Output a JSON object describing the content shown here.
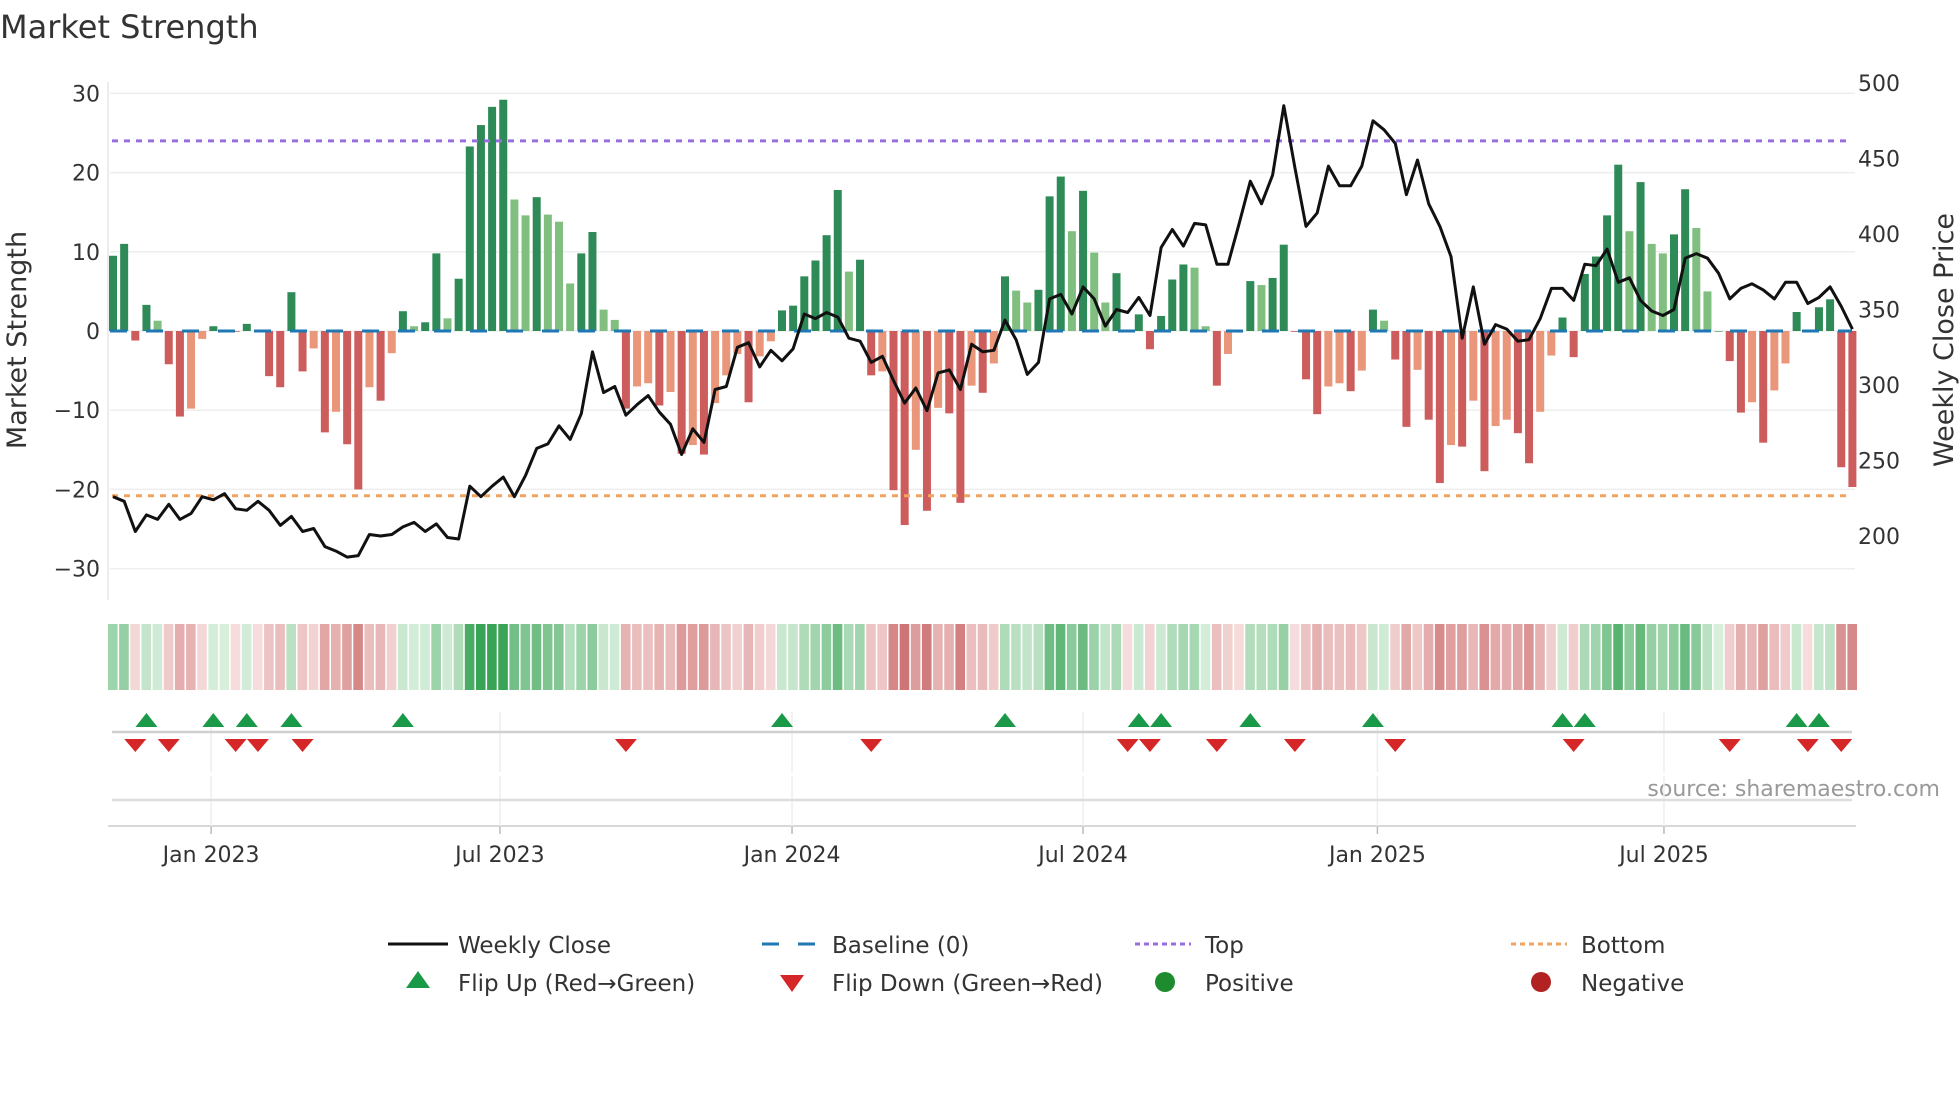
{
  "chart_data": {
    "type": "bar",
    "title": "Market Strength",
    "ylabel": "Market Strength",
    "y2label": "Weekly Close Price",
    "ylim": [
      -31.5,
      31.5
    ],
    "y2lim": [
      179,
      502
    ],
    "yticks": [
      30,
      20,
      10,
      0,
      -10,
      -20,
      -30
    ],
    "ytick_labels": [
      "30",
      "20",
      "10",
      "0",
      "−10",
      "−20",
      "−30"
    ],
    "y2ticks": [
      500,
      450,
      400,
      350,
      300,
      250,
      200
    ],
    "y2tick_labels": [
      "500",
      "450",
      "400",
      "350",
      "300",
      "250",
      "200"
    ],
    "x_unit": "week index",
    "xticks": [
      {
        "label": "Jan 2023",
        "week": 8.8
      },
      {
        "label": "Jul 2023",
        "week": 34.7
      },
      {
        "label": "Jan 2024",
        "week": 60.9
      },
      {
        "label": "Jul 2024",
        "week": 87.0
      },
      {
        "label": "Jan 2025",
        "week": 113.4
      },
      {
        "label": "Jul 2025",
        "week": 139.1
      }
    ],
    "reference_lines": {
      "baseline": 0,
      "top": 24,
      "bottom": -20.8
    },
    "series": [
      {
        "name": "Market Strength",
        "type": "bar",
        "values": [
          9.5,
          11,
          -1.2,
          3.3,
          1.3,
          -4.2,
          -10.8,
          -9.8,
          -1,
          0.6,
          0,
          -0.1,
          0.9,
          -0.1,
          -5.7,
          -7.1,
          4.9,
          -5.1,
          -2.2,
          -12.8,
          -10.2,
          -14.3,
          -20,
          -7.1,
          -8.8,
          -2.8,
          2.5,
          0.6,
          1.1,
          9.8,
          1.6,
          6.6,
          23.3,
          26,
          28.3,
          29.2,
          16.6,
          14.6,
          16.9,
          14.7,
          13.8,
          6,
          9.8,
          12.5,
          2.7,
          1.4,
          -9.8,
          -7,
          -6.6,
          -9.4,
          -7.7,
          -15.5,
          -14.4,
          -15.6,
          -9.1,
          -5.6,
          -2.9,
          -9,
          -3.2,
          -1.3,
          2.6,
          3.2,
          6.9,
          8.9,
          12.1,
          17.8,
          7.5,
          9,
          -5.6,
          -5.1,
          -20.1,
          -24.5,
          -15,
          -22.7,
          -9.7,
          -10.4,
          -21.7,
          -6.9,
          -7.8,
          -4.1,
          6.9,
          5.1,
          3.6,
          5.2,
          17,
          19.5,
          12.6,
          17.7,
          9.9,
          3.6,
          7.3,
          -0.1,
          2.1,
          -2.3,
          1.9,
          6.5,
          8.4,
          8,
          0.6,
          -6.9,
          -2.9,
          -0.2,
          6.3,
          5.8,
          6.7,
          10.9,
          -0.1,
          -6.1,
          -10.5,
          -7,
          -6.6,
          -7.6,
          -5,
          2.7,
          1.3,
          -3.6,
          -12.1,
          -4.9,
          -11.2,
          -19.2,
          -14.4,
          -14.6,
          -8.8,
          -17.7,
          -12,
          -11.2,
          -12.9,
          -16.7,
          -10.2,
          -3.1,
          1.7,
          -3.3,
          7.2,
          9.4,
          14.6,
          21,
          12.6,
          18.8,
          11,
          9.8,
          12.2,
          17.9,
          13,
          5,
          0,
          -3.8,
          -10.3,
          -9,
          -14.1,
          -7.5,
          -4.1,
          2.4,
          -0.1,
          3,
          4,
          -17.2,
          -19.7
        ]
      },
      {
        "name": "Weekly Close",
        "type": "line",
        "axis": "right",
        "values": [
          226,
          223,
          203,
          214,
          211,
          221,
          211,
          215,
          226,
          224,
          228,
          218,
          217,
          223,
          217,
          207,
          213,
          203,
          205,
          193,
          190,
          186,
          187,
          201,
          200,
          201,
          206,
          209,
          203,
          208,
          199,
          198,
          233,
          226,
          233,
          239,
          226,
          240,
          258,
          261,
          273,
          264,
          281,
          322,
          295,
          299,
          280,
          287,
          293,
          282,
          274,
          254,
          271,
          262,
          297,
          299,
          325,
          328,
          312,
          323,
          316,
          324,
          347,
          344,
          348,
          345,
          331,
          329,
          315,
          319,
          303,
          288,
          298,
          283,
          308,
          310,
          297,
          327,
          322,
          323,
          343,
          330,
          307,
          315,
          357,
          360,
          347,
          365,
          357,
          339,
          350,
          348,
          358,
          346,
          391,
          403,
          392,
          407,
          406,
          380,
          380,
          407,
          435,
          420,
          439,
          485,
          444,
          405,
          414,
          445,
          432,
          432,
          445,
          475,
          469,
          460,
          426,
          449,
          420,
          405,
          385,
          331,
          365,
          327,
          340,
          337,
          329,
          330,
          344,
          364,
          364,
          356,
          380,
          379,
          390,
          368,
          371,
          356,
          349,
          346,
          350,
          384,
          387,
          384,
          374,
          357,
          364,
          367,
          363,
          357,
          368,
          368,
          354,
          358,
          365,
          352,
          337
        ]
      }
    ],
    "flip_up_weeks": [
      3,
      9,
      12,
      16,
      26,
      60,
      80,
      92,
      94,
      102,
      113,
      130,
      132,
      151,
      153
    ],
    "flip_down_weeks": [
      2,
      5,
      11,
      13,
      17,
      46,
      68,
      91,
      93,
      99,
      106,
      115,
      131,
      145,
      152,
      155
    ],
    "legend": {
      "placement": "bottom",
      "items": [
        {
          "label": "Weekly Close",
          "kind": "line"
        },
        {
          "label": "Baseline (0)",
          "kind": "dash"
        },
        {
          "label": "Top",
          "kind": "dot-purple"
        },
        {
          "label": "Bottom",
          "kind": "dot-orange"
        },
        {
          "label": "Flip Up (Red→Green)",
          "kind": "tri-up"
        },
        {
          "label": "Flip Down (Green→Red)",
          "kind": "tri-down"
        },
        {
          "label": "Positive",
          "kind": "circle-green"
        },
        {
          "label": "Negative",
          "kind": "circle-red"
        }
      ]
    },
    "source": "source: sharemaestro.com",
    "colors": {
      "pos_strong": "#2e8b57",
      "pos_weak": "#80bf80",
      "neg_strong": "#cd5c5c",
      "neg_weak": "#e9967a",
      "close": "#111111",
      "baseline": "#1f77b4",
      "top": "#9b6ee0",
      "bottom": "#f0a45f",
      "flip_up": "#1a9a48",
      "flip_down": "#d62728",
      "positive": "#1e8c2e",
      "negative": "#b22222"
    }
  }
}
